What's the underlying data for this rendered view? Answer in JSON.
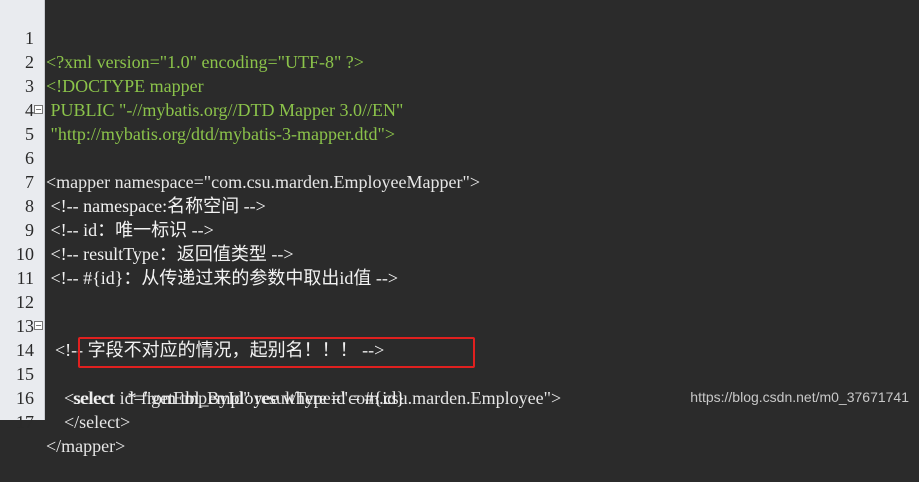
{
  "lines": [
    {
      "n": "1",
      "t": "<?xml version=\"1.0\" encoding=\"UTF-8\" ?>"
    },
    {
      "n": "2",
      "t": "<!DOCTYPE mapper"
    },
    {
      "n": "3",
      "t": " PUBLIC \"-//mybatis.org//DTD Mapper 3.0//EN\""
    },
    {
      "n": "4",
      "t": " \"http://mybatis.org/dtd/mybatis-3-mapper.dtd\">"
    },
    {
      "n": "5",
      "t": "<mapper namespace=\"com.csu.marden.EmployeeMapper\">"
    },
    {
      "n": "6",
      "t": ""
    },
    {
      "n": "7",
      "t": " <!-- namespace:名称空间 -->"
    },
    {
      "n": "8",
      "t": " <!-- id：唯一标识 -->"
    },
    {
      "n": "9",
      "t": " <!-- resultType：返回值类型 -->"
    },
    {
      "n": "10",
      "t": " <!-- #{id}：从传递过来的参数中取出id值 -->"
    },
    {
      "n": "11",
      "t": ""
    },
    {
      "n": "12",
      "t": ""
    },
    {
      "n": "13",
      "t": "  <!-- 字段不对应的情况，起别名！！！ -->"
    },
    {
      "n": "14",
      "t": "    <select id=\"getEmpById\" resultType=\"com.csu.marden.Employee\">"
    },
    {
      "n": "15",
      "t": "      select   * from tbl_employee where id = #{id}"
    },
    {
      "n": "16",
      "t": "    </select>"
    },
    {
      "n": "17",
      "t": "</mapper>"
    }
  ],
  "watermark": "https://blog.csdn.net/m0_37671741"
}
